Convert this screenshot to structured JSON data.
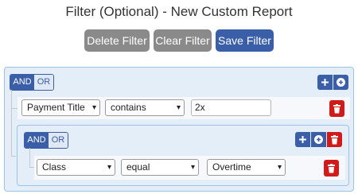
{
  "header": {
    "title": "Filter (Optional) - New Custom Report"
  },
  "toolbar": {
    "delete_label": "Delete Filter",
    "clear_label": "Clear Filter",
    "save_label": "Save Filter"
  },
  "colors": {
    "primary": "#3a5fa8",
    "danger": "#d11b1b",
    "neutral": "#8a8a8a",
    "group_bg": "#e3eef8"
  },
  "outer_group": {
    "and_label": "AND",
    "or_label": "OR",
    "active": "AND",
    "rule": {
      "field": "Payment Title",
      "operator": "contains",
      "value": "2x"
    }
  },
  "inner_group": {
    "and_label": "AND",
    "or_label": "OR",
    "active": "AND",
    "rule": {
      "field": "Class",
      "operator": "equal",
      "value": "Overtime"
    }
  },
  "icons": {
    "add_rule": "plus-icon",
    "add_group": "plus-circle-icon",
    "delete": "trash-icon",
    "dropdown": "chevron-down-icon"
  }
}
